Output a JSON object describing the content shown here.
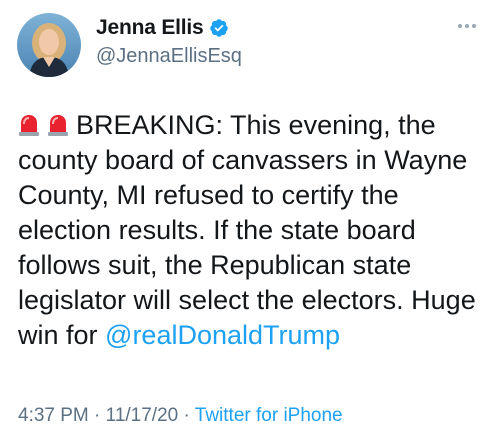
{
  "author": {
    "display_name": "Jenna Ellis",
    "handle": "@JennaEllisEsq",
    "verified": true
  },
  "icons": {
    "more": "more-options-icon",
    "verified": "verified-badge-icon",
    "emoji": "police-car-light-emoji"
  },
  "tweet": {
    "lines": [
      "BREAKING: This evening, the",
      "county board of canvassers in Wayne",
      "County, MI refused to certify the",
      "election results.  If the state board",
      "follows suit, the Republican state",
      "legislator will select the electors. Huge",
      "win for "
    ],
    "mention": "@realDonaldTrump"
  },
  "meta": {
    "time": "4:37 PM",
    "separator1": " · ",
    "date": "11/17/20",
    "separator2": " · ",
    "source": "Twitter for iPhone"
  },
  "colors": {
    "link": "#1da1f2",
    "secondary": "#5b7083",
    "text": "#14171a"
  }
}
